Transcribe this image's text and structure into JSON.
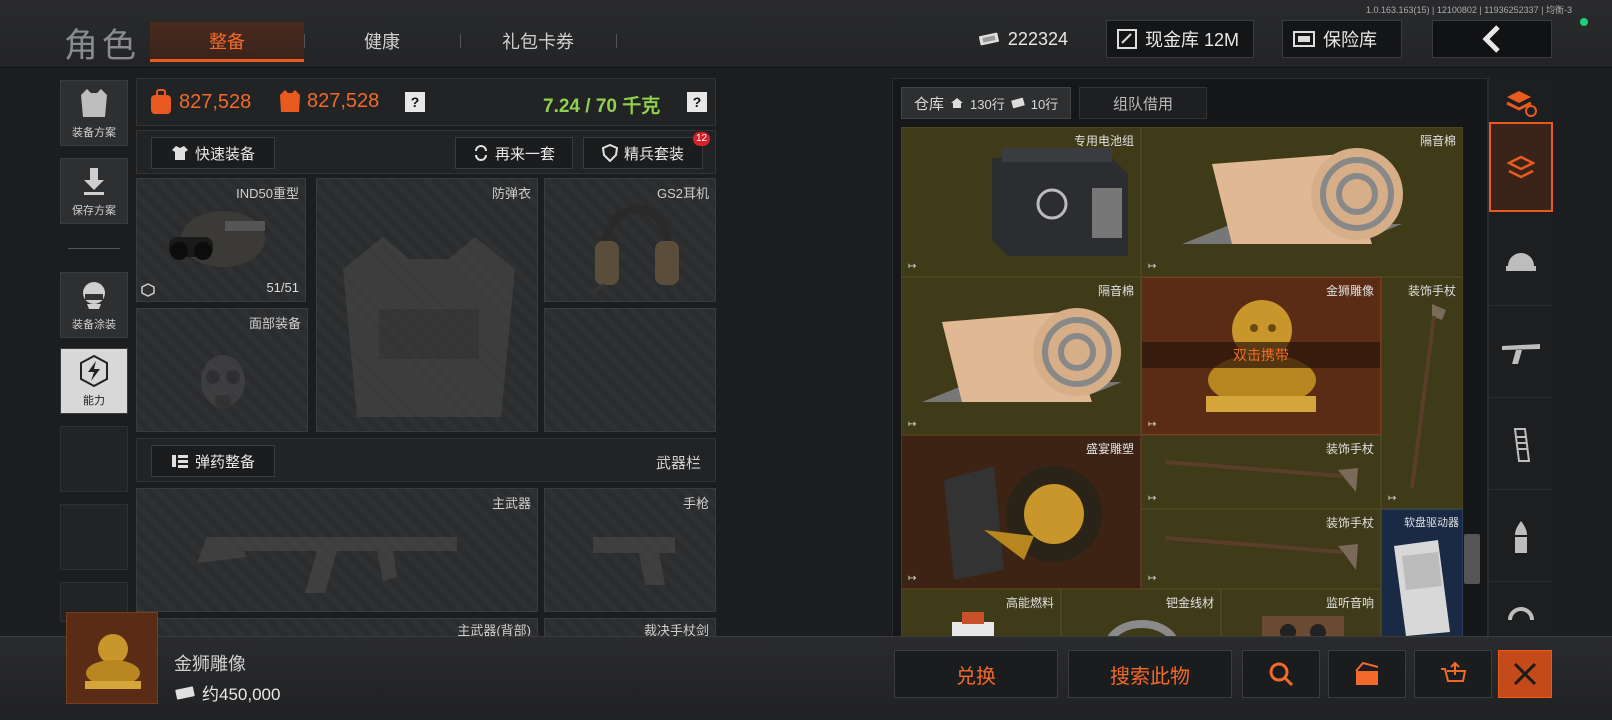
{
  "version": "1.0.163.163(15) | 12100802 | 11936252337 | 均衡-3",
  "header": {
    "title": "角色",
    "tabs": [
      {
        "label": "整备",
        "active": true
      },
      {
        "label": "健康",
        "active": false
      },
      {
        "label": "礼包卡券",
        "active": false
      }
    ],
    "currency": "222324",
    "cash_vault": "现金库 12M",
    "insurance": "保险库"
  },
  "left_nav": {
    "items": [
      {
        "label": "装备方案",
        "icon": "vest-icon"
      },
      {
        "label": "保存方案",
        "icon": "download-icon"
      },
      {
        "label": "装备涂装",
        "icon": "helmet-icon"
      },
      {
        "label": "能力",
        "icon": "lightning-icon",
        "active": true
      }
    ]
  },
  "equipment": {
    "backpack_value": "827,528",
    "armor_value": "827,528",
    "weight": "7.24 / 70 千克",
    "quick_equip": "快速装备",
    "reroll": "再来一套",
    "elite_set": "精兵套装",
    "elite_badge": "12",
    "slots": {
      "helmet_label": "IND50重型",
      "helmet_durability": "51/51",
      "armor_label": "防弹衣",
      "headset_label": "GS2耳机",
      "face_label": "面部装备"
    },
    "ammo_prep": "弹药整备",
    "weapon_bar": "武器栏",
    "primary_weapon": "主武器",
    "pistol": "手枪",
    "primary_back": "主武器(背部)",
    "melee": "裁决手杖剑"
  },
  "warehouse": {
    "tab_label": "仓库",
    "rows_home": "130行",
    "rows_ticket": "10行",
    "team_borrow": "组队借用",
    "double_click_hint": "双击携带",
    "items": [
      {
        "name": "专用电池组",
        "tone": "yellow"
      },
      {
        "name": "隔音棉",
        "tone": "yellow"
      },
      {
        "name": "隔音棉",
        "tone": "yellow"
      },
      {
        "name": "金狮雕像",
        "tone": "selected"
      },
      {
        "name": "装饰手杖",
        "tone": "yellow"
      },
      {
        "name": "盛宴雕塑",
        "tone": "red"
      },
      {
        "name": "装饰手杖",
        "tone": "yellow"
      },
      {
        "name": "装饰手杖",
        "tone": "yellow"
      },
      {
        "name": "软盘驱动器",
        "tone": "blue"
      },
      {
        "name": "高能燃料",
        "tone": "yellow"
      },
      {
        "name": "钯金线材",
        "tone": "yellow"
      },
      {
        "name": "监听音响",
        "tone": "yellow"
      }
    ]
  },
  "selected_item": {
    "name": "金狮雕像",
    "price": "约450,000"
  },
  "actions": {
    "exchange": "兑换",
    "search_item": "搜索此物"
  },
  "colors": {
    "accent": "#e85a20",
    "weight_green": "#8fd14f",
    "gold_cell": "#3f3a18"
  }
}
